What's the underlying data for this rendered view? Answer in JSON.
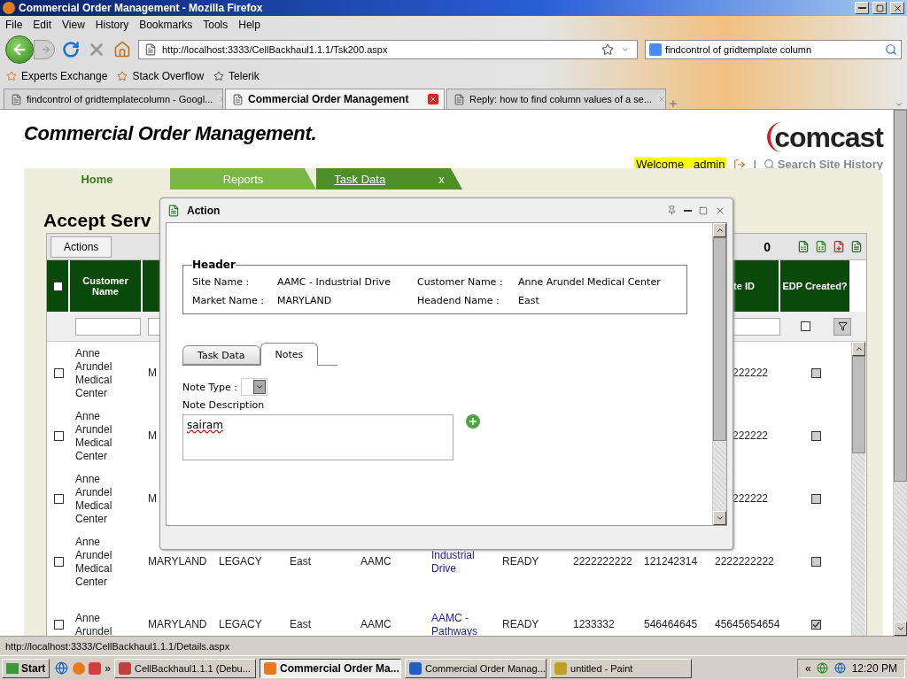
{
  "window": {
    "title": "Commercial Order Management - Mozilla Firefox"
  },
  "menu": [
    "File",
    "Edit",
    "View",
    "History",
    "Bookmarks",
    "Tools",
    "Help"
  ],
  "address_bar": {
    "url": "http://localhost:3333/CellBackhaul1.1.1/Tsk200.aspx"
  },
  "search_bar": {
    "value": "findcontrol of gridtemplate column"
  },
  "bookmarks": [
    "Experts Exchange",
    "Stack Overflow",
    "Telerik"
  ],
  "browser_tabs": [
    {
      "label": "findcontrol of gridtemplatecolumn - Googl...",
      "selected": false
    },
    {
      "label": "Commercial Order Management",
      "selected": true
    },
    {
      "label": "Reply: how to find column values of a se...",
      "selected": false
    }
  ],
  "page": {
    "title": "Commercial Order Management.",
    "logo": "comcast",
    "welcome": "Welcome   admin",
    "separator": "|",
    "search_history": "Search Site History",
    "nav_tabs": [
      {
        "label": "Home",
        "selected": true
      },
      {
        "label": "Reports",
        "selected": false
      },
      {
        "label": "Task Data",
        "selected": false,
        "close": "x"
      }
    ],
    "heading": "Accept Serv"
  },
  "grid": {
    "actions_button": "Actions",
    "page_info": "0",
    "select_all_checked": false,
    "filter_checked": false,
    "header": {
      "column_1": "Customer Name",
      "column_10": "te ID",
      "column_11": "EDP Created?"
    },
    "rows": [
      {
        "checked": false,
        "edp_created": false,
        "cells": {
          "column_1": "Anne Arundel Medical Center",
          "column_2": "M",
          "column_10": "222222"
        }
      },
      {
        "checked": false,
        "edp_created": false,
        "cells": {
          "column_1": "Anne Arundel Medical Center",
          "column_2": "M",
          "column_10": "222222"
        }
      },
      {
        "checked": false,
        "edp_created": false,
        "cells": {
          "column_1": "Anne Arundel Medical Center",
          "column_2": "M",
          "column_10": "222222"
        }
      },
      {
        "checked": false,
        "edp_created": false,
        "cells": {
          "column_1": "Anne Arundel Medical Center",
          "column_2": "MARYLAND",
          "column_3": "LEGACY",
          "column_4": "East",
          "column_5": "AAMC",
          "column_6": "Industrial Drive",
          "column_7": "READY",
          "column_8": "2222222222",
          "column_9": "121242314",
          "column_10": "2222222222"
        }
      },
      {
        "checked": false,
        "edp_created": true,
        "cells": {
          "column_1": "Anne Arundel",
          "column_2": "MARYLAND",
          "column_3": "LEGACY",
          "column_4": "East",
          "column_5": "AAMC",
          "column_6": "AAMC - Pathways",
          "column_7": "READY",
          "column_8": "1233332",
          "column_9": "546464645",
          "column_10": "45645654654"
        }
      }
    ]
  },
  "dialog": {
    "title": "Action",
    "header": {
      "legend": "Header",
      "fields": [
        {
          "label": "Site Name :",
          "value": "AAMC - Industrial Drive"
        },
        {
          "label": "Customer Name :",
          "value": "Anne Arundel Medical Center"
        },
        {
          "label": "Market Name :",
          "value": "MARYLAND"
        },
        {
          "label": "Headend Name :",
          "value": "East"
        }
      ]
    },
    "tabs": [
      {
        "label": "Task Data",
        "selected": false
      },
      {
        "label": "Notes",
        "selected": true
      }
    ],
    "note_type_label": "Note Type :",
    "note_description_label": "Note Description",
    "note_description": "sairam"
  },
  "status_bar": {
    "url": "http://localhost:3333/CellBackhaul1.1.1/Details.aspx"
  },
  "taskbar": {
    "start": "Start",
    "more": "»",
    "buttons": [
      {
        "label": "CellBackhaul1.1.1 (Debu...",
        "selected": false
      },
      {
        "label": "Commercial Order Ma...",
        "selected": true
      },
      {
        "label": "Commercial Order Manag...",
        "selected": false
      },
      {
        "label": "untitled - Paint",
        "selected": false
      }
    ],
    "tray_chevron": "«",
    "clock": "12:20 PM"
  }
}
